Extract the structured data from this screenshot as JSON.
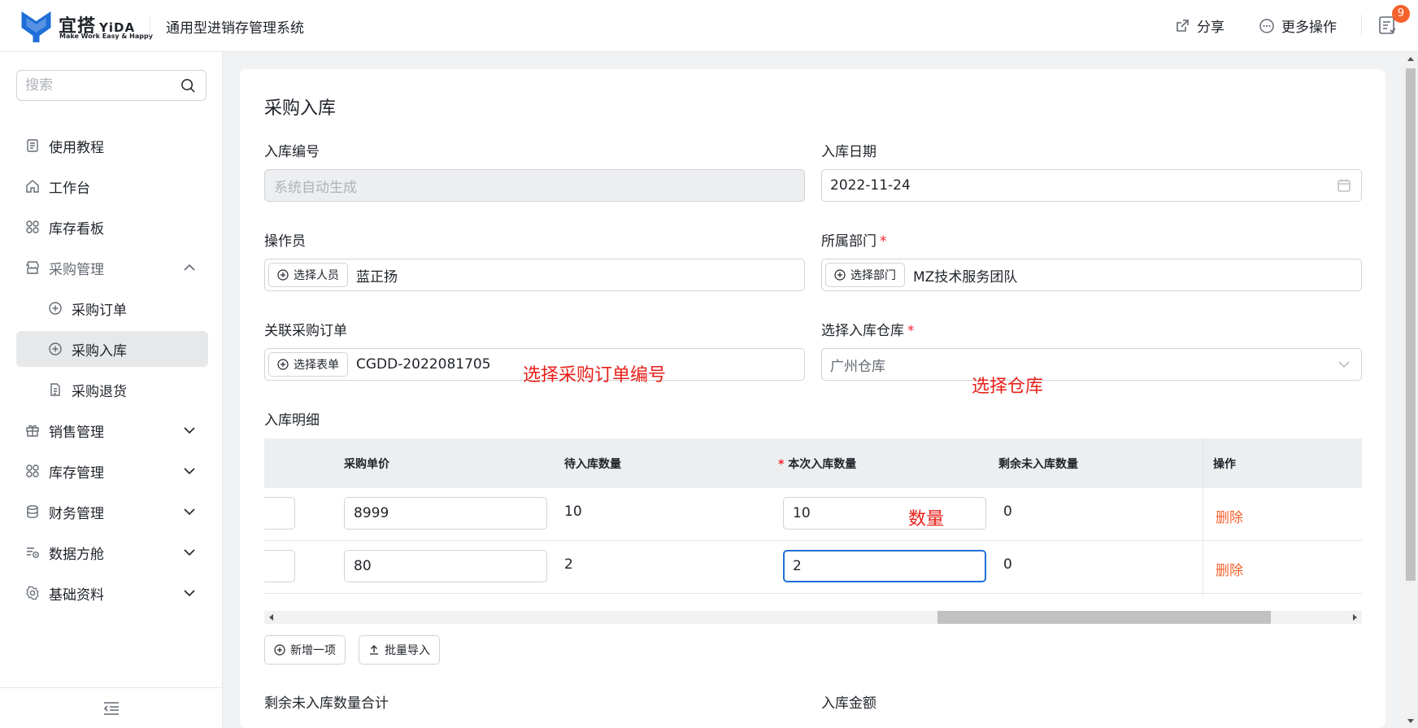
{
  "header": {
    "logo_cn": "宜搭",
    "logo_en": "YiDA",
    "logo_slogan": "Make Work Easy & Happy",
    "app_title": "通用型进销存管理系统",
    "share_label": "分享",
    "more_label": "更多操作",
    "notification_count": "9"
  },
  "sidebar": {
    "search_placeholder": "搜索",
    "items": [
      {
        "label": "使用教程",
        "icon": "document-icon"
      },
      {
        "label": "工作台",
        "icon": "home-icon"
      },
      {
        "label": "库存看板",
        "icon": "grid-icon"
      },
      {
        "label": "采购管理",
        "icon": "store-icon",
        "expanded": true
      },
      {
        "label": "采购订单",
        "icon": "plus-circle-icon"
      },
      {
        "label": "采购入库",
        "icon": "plus-circle-icon",
        "active": true
      },
      {
        "label": "采购退货",
        "icon": "file-icon"
      },
      {
        "label": "销售管理",
        "icon": "gift-icon"
      },
      {
        "label": "库存管理",
        "icon": "grid-icon"
      },
      {
        "label": "财务管理",
        "icon": "database-icon"
      },
      {
        "label": "数据方舱",
        "icon": "data-icon"
      },
      {
        "label": "基础资料",
        "icon": "gear-icon"
      }
    ]
  },
  "form": {
    "title": "采购入库",
    "receipt_no_label": "入库编号",
    "receipt_no_placeholder": "系统自动生成",
    "date_label": "入库日期",
    "date_value": "2022-11-24",
    "operator_label": "操作员",
    "operator_button": "选择人员",
    "operator_value": "蓝正扬",
    "dept_label": "所属部门",
    "dept_button": "选择部门",
    "dept_value": "MZ技术服务团队",
    "order_label": "关联采购订单",
    "order_button": "选择表单",
    "order_value": "CGDD-2022081705",
    "warehouse_label": "选择入库仓库",
    "warehouse_value": "广州仓库",
    "detail_label": "入库明细",
    "total_remaining_label": "剩余未入库数量合计",
    "amount_label": "入库金额"
  },
  "annotations": {
    "order": "选择采购订单编号",
    "warehouse": "选择仓库",
    "quantity": "数量"
  },
  "table": {
    "headers": {
      "unit_price": "采购单价",
      "pending_qty": "待入库数量",
      "this_qty_star": "*",
      "this_qty": "本次入库数量",
      "remaining_qty": "剩余未入库数量",
      "action": "操作"
    },
    "rows": [
      {
        "unit_price": "8999",
        "pending": "10",
        "this_qty": "10",
        "remaining": "0",
        "action": "删除"
      },
      {
        "unit_price": "80",
        "pending": "2",
        "this_qty": "2",
        "remaining": "0",
        "action": "删除"
      }
    ],
    "add_button": "新增一项",
    "import_button": "批量导入"
  },
  "colors": {
    "accent": "#f5622d",
    "brand": "#1f6fd8",
    "annotation": "#e8201a"
  }
}
